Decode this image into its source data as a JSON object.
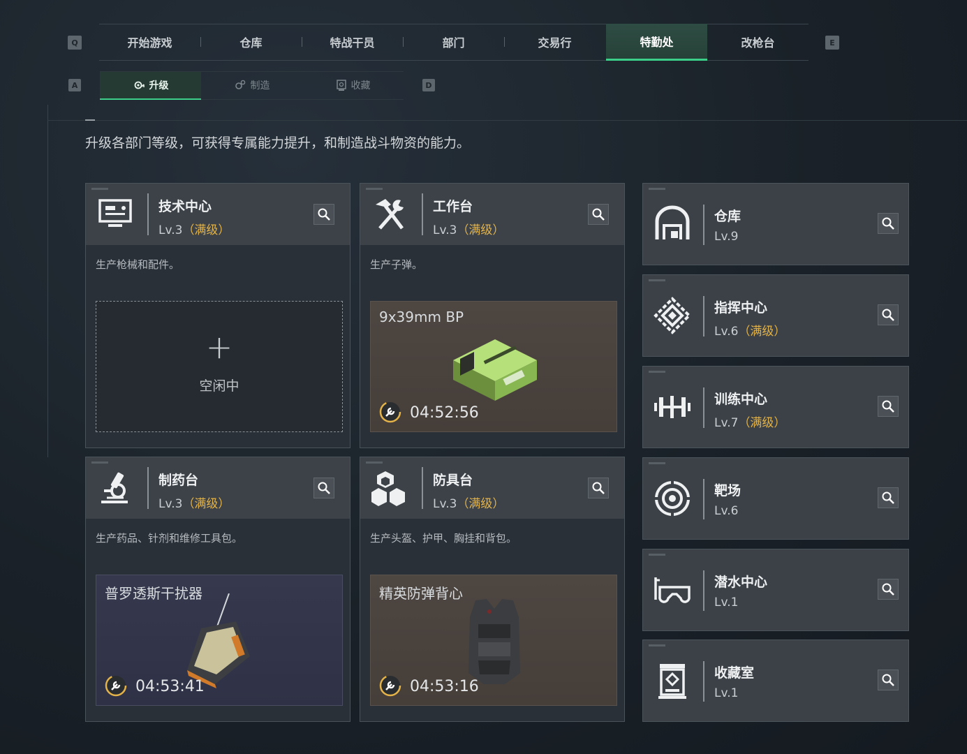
{
  "nav": {
    "left_key": "Q",
    "right_key": "E",
    "tabs": [
      "开始游戏",
      "仓库",
      "特战干员",
      "部门",
      "交易行",
      "特勤处",
      "改枪台"
    ],
    "active_index": 5
  },
  "subnav": {
    "left_key": "A",
    "right_key": "D",
    "tabs": [
      "升级",
      "制造",
      "收藏"
    ],
    "active_index": 0
  },
  "description": "升级各部门等级，可获得专属能力提升，和制造战斗物资的能力。",
  "cards": [
    {
      "name": "技术中心",
      "level": "Lv.3",
      "max": "（满级）",
      "desc": "生产枪械和配件。",
      "state": "idle",
      "idle_label": "空闲中",
      "plus": "+",
      "icon": "monitor-icon"
    },
    {
      "name": "工作台",
      "level": "Lv.3",
      "max": "（满级）",
      "desc": "生产子弹。",
      "state": "producing",
      "product": "9x39mm BP",
      "timer": "04:52:56",
      "icon": "hammer-wrench-icon",
      "bg": "#4a423d"
    },
    {
      "name": "制药台",
      "level": "Lv.3",
      "max": "（满级）",
      "desc": "生产药品、针剂和维修工具包。",
      "state": "producing",
      "product": "普罗透斯干扰器",
      "timer": "04:53:41",
      "icon": "microscope-icon",
      "bg": "#33354a"
    },
    {
      "name": "防具台",
      "level": "Lv.3",
      "max": "（满级）",
      "desc": "生产头盔、护甲、胸挂和背包。",
      "state": "producing",
      "product": "精英防弹背心",
      "timer": "04:53:16",
      "icon": "armor-blocks-icon",
      "bg": "#4a423d"
    }
  ],
  "facilities": [
    {
      "name": "仓库",
      "level": "Lv.9",
      "max": "",
      "icon": "warehouse-icon"
    },
    {
      "name": "指挥中心",
      "level": "Lv.6",
      "max": "（满级）",
      "icon": "command-icon"
    },
    {
      "name": "训练中心",
      "level": "Lv.7",
      "max": "（满级）",
      "icon": "dumbbell-icon"
    },
    {
      "name": "靶场",
      "level": "Lv.6",
      "max": "",
      "icon": "target-icon"
    },
    {
      "name": "潜水中心",
      "level": "Lv.1",
      "max": "",
      "icon": "dive-mask-icon"
    },
    {
      "name": "收藏室",
      "level": "Lv.1",
      "max": "",
      "icon": "collection-icon"
    }
  ],
  "colors": {
    "accent": "#3ccf8a",
    "max_level": "#e3b34a"
  }
}
